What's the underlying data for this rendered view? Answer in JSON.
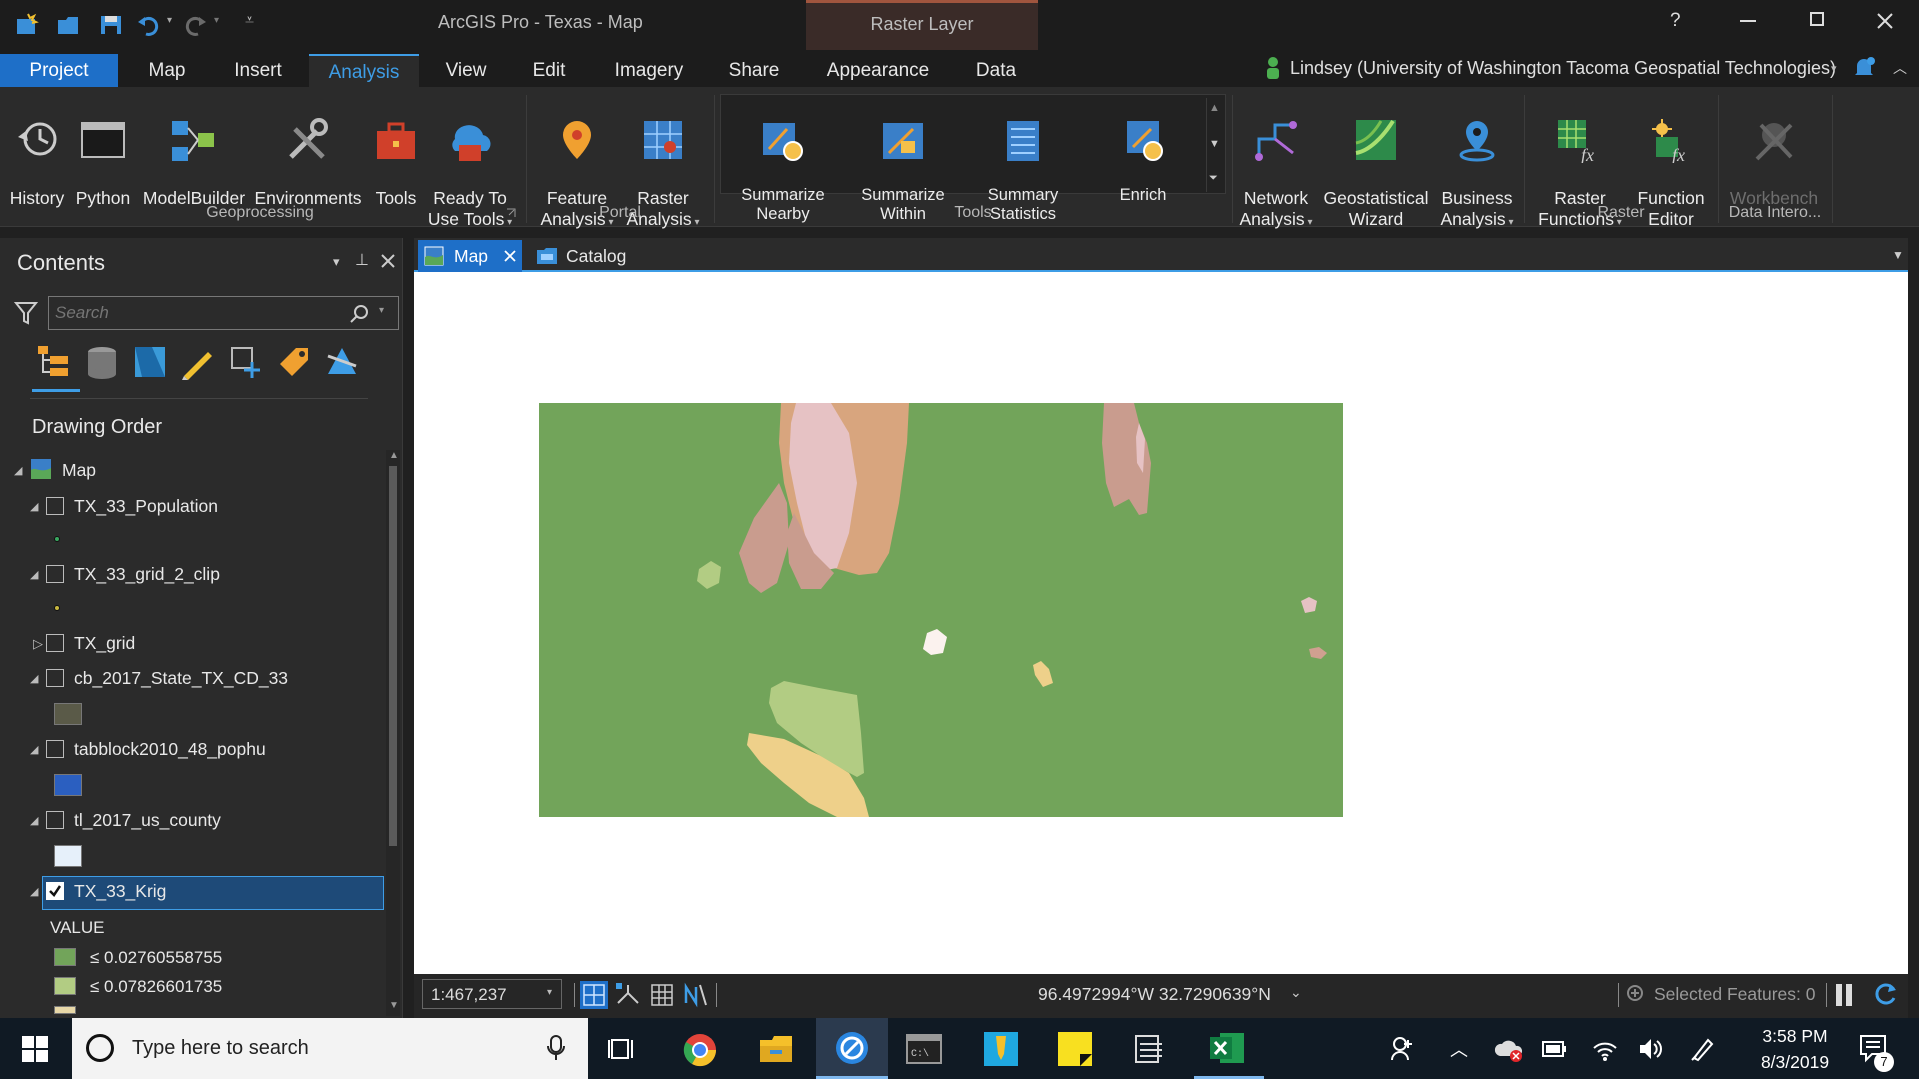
{
  "titlebar": {
    "title": "ArcGIS Pro - Texas - Map",
    "context": "Raster Layer",
    "help": "?"
  },
  "ribbon_tabs": [
    "Project",
    "Map",
    "Insert",
    "Analysis",
    "View",
    "Edit",
    "Imagery",
    "Share",
    "Appearance",
    "Data"
  ],
  "active_tab": "Analysis",
  "user": "Lindsey (University of Washington Tacoma Geospatial Technologies)",
  "geoprocessing": {
    "group": "Geoprocessing",
    "buttons": [
      "History",
      "Python",
      "ModelBuilder",
      "Environments",
      "Tools",
      "Ready To\nUse Tools"
    ]
  },
  "portal": {
    "group": "Portal",
    "buttons": [
      "Feature\nAnalysis",
      "Raster\nAnalysis"
    ]
  },
  "tools": {
    "group": "Tools",
    "buttons": [
      "Summarize\nNearby",
      "Summarize\nWithin",
      "Summary\nStatistics",
      "Enrich"
    ]
  },
  "other": {
    "buttons": [
      "Network\nAnalysis",
      "Geostatistical\nWizard",
      "Business\nAnalysis"
    ]
  },
  "raster": {
    "group": "Raster",
    "buttons": [
      "Raster\nFunctions",
      "Function\nEditor"
    ]
  },
  "datainterop": {
    "group": "Data Intero...",
    "buttons": [
      "Workbench"
    ]
  },
  "contents": {
    "title": "Contents",
    "search_placeholder": "Search",
    "drawing_order": "Drawing Order",
    "map": "Map",
    "layers": [
      {
        "name": "TX_33_Population",
        "checked": false
      },
      {
        "name": "TX_33_grid_2_clip",
        "checked": false
      },
      {
        "name": "TX_grid",
        "checked": false
      },
      {
        "name": "cb_2017_State_TX_CD_33",
        "checked": false
      },
      {
        "name": "tabblock2010_48_pophu",
        "checked": false
      },
      {
        "name": "tl_2017_us_county",
        "checked": false
      },
      {
        "name": "TX_33_Krig",
        "checked": true
      }
    ],
    "legend_title": "VALUE",
    "legend": [
      {
        "label": "≤ 0.02760558755",
        "color": "#72a45a"
      },
      {
        "label": "≤ 0.07826601735",
        "color": "#b2cc83"
      }
    ]
  },
  "view_tabs": {
    "map": "Map",
    "catalog": "Catalog"
  },
  "status": {
    "scale": "1:467,237",
    "coords": "96.4972994°W 32.7290639°N",
    "selected": "Selected Features: 0"
  },
  "taskbar": {
    "search": "Type here to search",
    "time": "3:58 PM",
    "date": "8/3/2019",
    "notifications": "7"
  }
}
